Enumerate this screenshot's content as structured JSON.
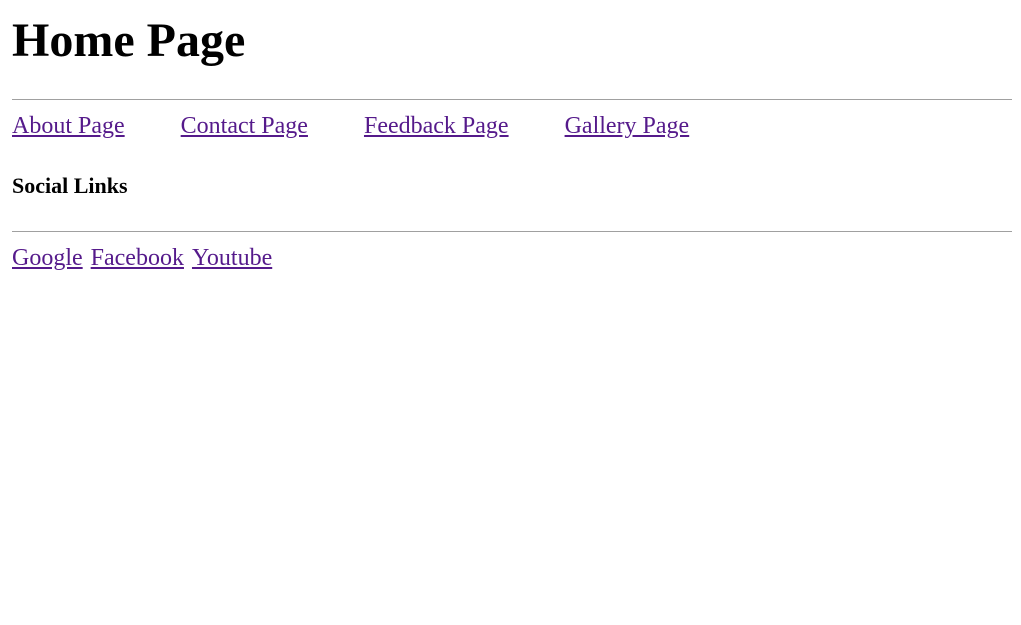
{
  "page": {
    "title": "Home Page"
  },
  "nav": {
    "links": [
      {
        "label": "About Page"
      },
      {
        "label": "Contact Page"
      },
      {
        "label": "Feedback Page"
      },
      {
        "label": "Gallery Page"
      }
    ]
  },
  "social": {
    "heading": "Social Links",
    "links": [
      {
        "label": "Google"
      },
      {
        "label": "Facebook"
      },
      {
        "label": "Youtube"
      }
    ]
  },
  "colors": {
    "link_visited": "#551a8b",
    "rule": "#a0a0a0",
    "text": "#000000",
    "background": "#ffffff"
  }
}
